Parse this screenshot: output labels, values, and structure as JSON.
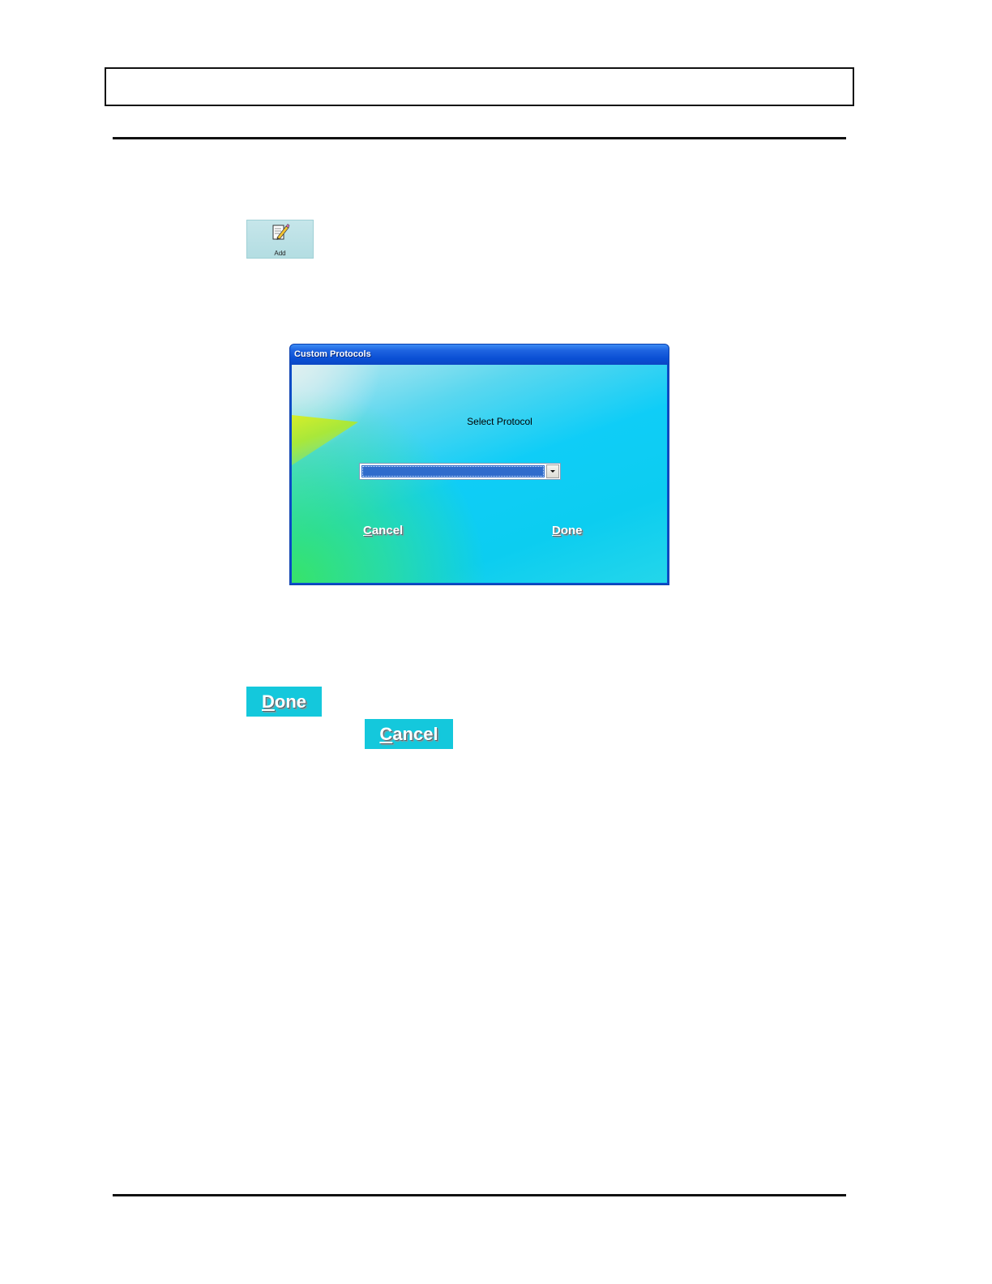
{
  "add_button": {
    "label": "Add",
    "icon": "notepad-pencil-icon"
  },
  "dialog": {
    "title": "Custom Protocols",
    "prompt": "Select Protocol",
    "select": {
      "value": "",
      "icon": "chevron-down-icon"
    },
    "cancel": {
      "first": "C",
      "rest": "ancel"
    },
    "done": {
      "first": "D",
      "rest": "one"
    }
  },
  "done_button": {
    "first": "D",
    "rest": "one"
  },
  "cancel_button": {
    "first": "C",
    "rest": "ancel"
  },
  "colors": {
    "button_bg": "#14c8dc",
    "titlebar": "#0a4fd4",
    "select_highlight": "#2f6ccc"
  }
}
